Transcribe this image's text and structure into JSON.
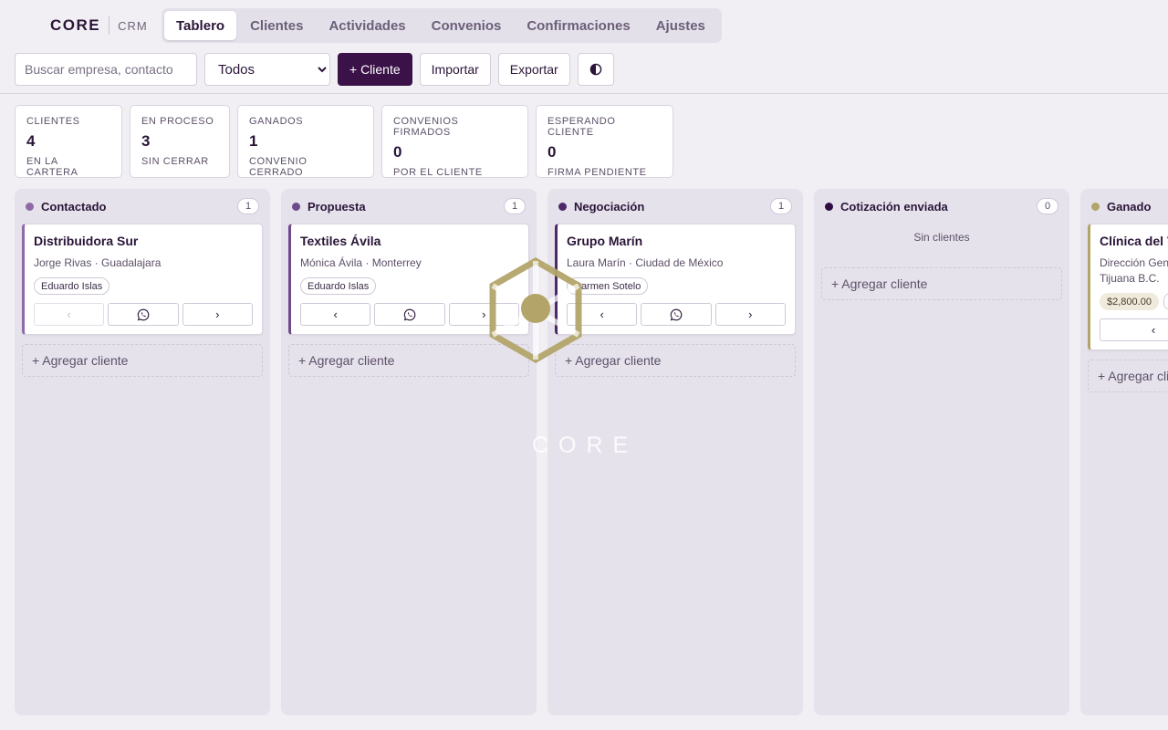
{
  "brand": {
    "name": "CORE",
    "product": "CRM"
  },
  "nav": {
    "tabs": [
      "Tablero",
      "Clientes",
      "Actividades",
      "Convenios",
      "Confirmaciones",
      "Ajustes"
    ],
    "active": "Tablero"
  },
  "toolbar": {
    "search_placeholder": "Buscar empresa, contacto",
    "filter_selected": "Todos",
    "add_client": "+ Cliente",
    "import": "Importar",
    "export": "Exportar",
    "theme_icon": "contrast-icon"
  },
  "stats": [
    {
      "label": "CLIENTES",
      "value": "4",
      "sub": "EN LA CARTERA"
    },
    {
      "label": "EN PROCESO",
      "value": "3",
      "sub": "SIN CERRAR"
    },
    {
      "label": "GANADOS",
      "value": "1",
      "sub": "CONVENIO CERRADO"
    },
    {
      "label": "CONVENIOS FIRMADOS",
      "value": "0",
      "sub": "POR EL CLIENTE"
    },
    {
      "label": "ESPERANDO CLIENTE",
      "value": "0",
      "sub": "FIRMA PENDIENTE"
    }
  ],
  "columns": [
    {
      "title": "Contactado",
      "count": "1",
      "color": "#8e6aa6",
      "card": {
        "title": "Distribuidora Sur",
        "subtitle": "Jorge Rivas · Guadalajara",
        "owner": "Eduardo Islas"
      }
    },
    {
      "title": "Propuesta",
      "count": "1",
      "color": "#6e4a8a",
      "card": {
        "title": "Textiles Ávila",
        "subtitle": "Mónica Ávila · Monterrey",
        "owner": "Eduardo Islas"
      }
    },
    {
      "title": "Negociación",
      "count": "1",
      "color": "#4e2a68",
      "card": {
        "title": "Grupo Marín",
        "subtitle": "Laura Marín · Ciudad de México",
        "owner": "Carmen Sotelo"
      }
    },
    {
      "title": "Cotización enviada",
      "count": "0",
      "color": "#2e0f40",
      "empty": "Sin clientes"
    },
    {
      "title": "Ganado",
      "count": "1",
      "color": "#b3a46a",
      "card": {
        "title": "Clínica del V",
        "subtitle": "Dirección Gen",
        "subtitle2": "Tijuana B.C.",
        "amount": "$2,800.00"
      }
    }
  ],
  "add_client_label": "+ Agregar cliente",
  "watermark": {
    "text": "CORE",
    "color": "#b3a46a"
  },
  "icons": {
    "prev": "‹",
    "next": "›",
    "whatsapp": "whatsapp-icon"
  }
}
